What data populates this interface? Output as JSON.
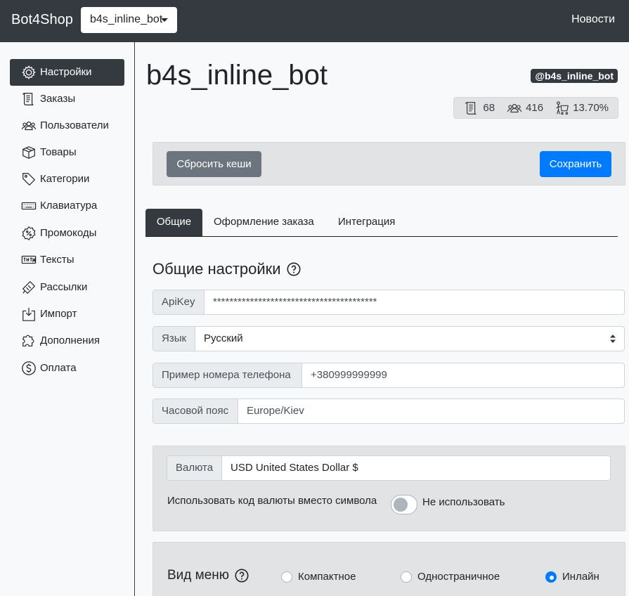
{
  "navbar": {
    "brand": "Bot4Shop",
    "bot_selector": "b4s_inline_bot",
    "news_link": "Новости"
  },
  "sidebar": {
    "items": [
      {
        "label": "Настройки",
        "icon": "gear-icon",
        "active": true
      },
      {
        "label": "Заказы",
        "icon": "scroll-icon"
      },
      {
        "label": "Пользователи",
        "icon": "users-icon"
      },
      {
        "label": "Товары",
        "icon": "box-icon"
      },
      {
        "label": "Категории",
        "icon": "tag-icon"
      },
      {
        "label": "Клавиатура",
        "icon": "keyboard-icon"
      },
      {
        "label": "Промокоды",
        "icon": "percent-badge-icon"
      },
      {
        "label": "Тексты",
        "icon": "text-icon"
      },
      {
        "label": "Рассылки",
        "icon": "megaphone-icon"
      },
      {
        "label": "Импорт",
        "icon": "import-icon"
      },
      {
        "label": "Дополнения",
        "icon": "puzzle-icon"
      },
      {
        "label": "Оплата",
        "icon": "dollar-icon"
      }
    ]
  },
  "header": {
    "title": "b4s_inline_bot",
    "handle": "@b4s_inline_bot",
    "stats": {
      "orders": "68",
      "users": "416",
      "conversion": "13.70%"
    }
  },
  "toolbar": {
    "reset_label": "Сбросить кеши",
    "save_label": "Сохранить"
  },
  "tabs": [
    {
      "label": "Общие",
      "active": true
    },
    {
      "label": "Оформление заказа"
    },
    {
      "label": "Интеграция"
    }
  ],
  "general": {
    "title": "Общие настройки",
    "apikey": {
      "label": "ApiKey",
      "value": "****************************************"
    },
    "language": {
      "label": "Язык",
      "value": "Русский"
    },
    "phone_example": {
      "label": "Пример номера телефона",
      "value": "+380999999999"
    },
    "timezone": {
      "label": "Часовой пояс",
      "value": "Europe/Kiev"
    }
  },
  "currency": {
    "label": "Валюта",
    "value": "USD United States Dollar $",
    "toggle_label": "Использовать код валюты вместо символа",
    "toggle_state_label": "Не использовать",
    "toggle_on": false
  },
  "menu_view": {
    "title": "Вид меню",
    "options": [
      {
        "label": "Компактное",
        "selected": false
      },
      {
        "label": "Одностраничное",
        "selected": false
      },
      {
        "label": "Инлайн",
        "selected": true
      }
    ]
  },
  "colors": {
    "dark": "#343a40",
    "primary": "#007bff",
    "secondary": "#6c757d",
    "panel": "#e2e3e5"
  }
}
